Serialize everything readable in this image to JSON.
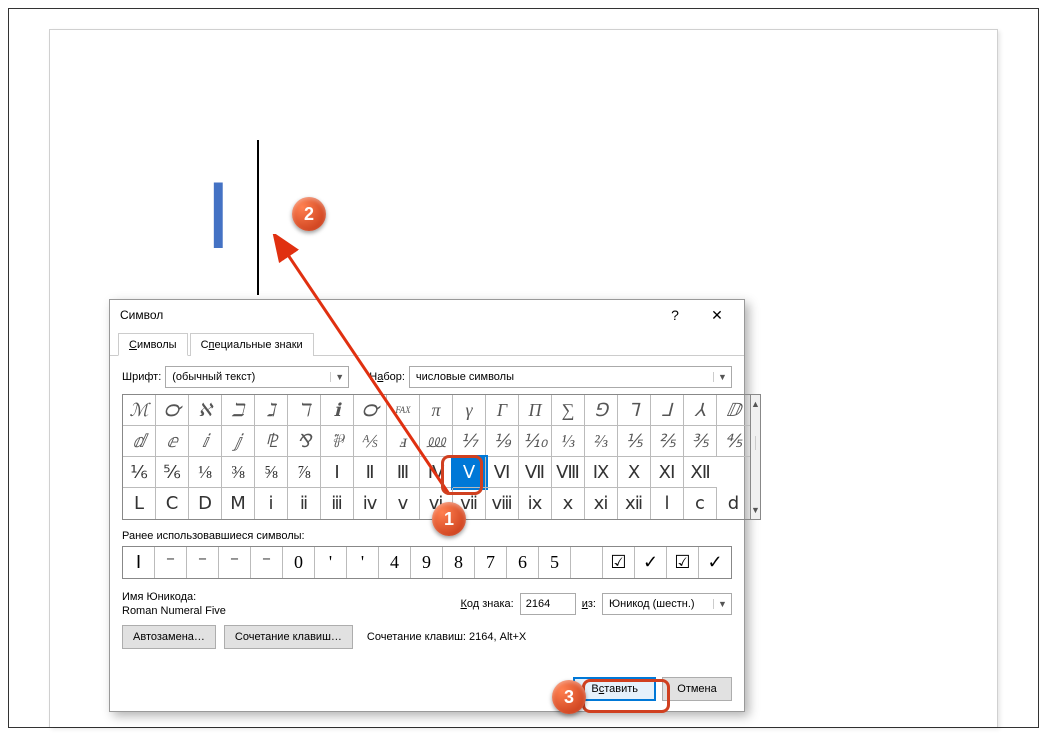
{
  "document": {
    "inserted_char": "Ⅰ"
  },
  "dialog": {
    "title": "Символ",
    "help": "?",
    "close": "✕",
    "tabs": {
      "symbols": "Символы",
      "special": "Специальные знаки"
    },
    "font_label": "Шрифт:",
    "font_value": "(обычный текст)",
    "set_label": "Набор:",
    "set_value": "числовые символы",
    "recent_label": "Ранее использовавшиеся символы:",
    "unicode_name_label": "Имя Юникода:",
    "unicode_name": "Roman Numeral Five",
    "code_label": "Код знака:",
    "code_value": "2164",
    "from_label": "из:",
    "from_value": "Юникод (шестн.)",
    "autocorrect": "Автозамена…",
    "shortcut_btn": "Сочетание клавиш…",
    "shortcut_text": "Сочетание клавиш: 2164, Alt+X",
    "insert": "Вставить",
    "cancel": "Отмена"
  },
  "grid": {
    "r1": [
      "ℳ",
      "℺",
      "ℵ",
      "ℶ",
      "ℷ",
      "ℸ",
      "ℹ",
      "℺",
      "FAX",
      "π",
      "γ",
      "Γ",
      "Π",
      "∑",
      "⅁",
      "⅂",
      "⅃",
      "⅄",
      "ⅅ"
    ],
    "r2": [
      "ⅆ",
      "ⅇ",
      "ⅈ",
      "ⅉ",
      "⅊",
      "⅋",
      "⅌",
      "⅍",
      "ⅎ",
      "⅏",
      "⅐",
      "⅑",
      "⅒",
      "⅓",
      "⅔",
      "⅕",
      "⅖",
      "⅗",
      "⅘"
    ],
    "r3": [
      "⅙",
      "⅚",
      "⅛",
      "⅜",
      "⅝",
      "⅞",
      "Ⅰ",
      "Ⅱ",
      "Ⅲ",
      "Ⅳ",
      "Ⅴ",
      "Ⅵ",
      "Ⅶ",
      "Ⅷ",
      "Ⅸ",
      "Ⅹ",
      "Ⅺ",
      "Ⅻ"
    ],
    "r4": [
      "Ⅼ",
      "Ⅽ",
      "Ⅾ",
      "Ⅿ",
      "ⅰ",
      "ⅱ",
      "ⅲ",
      "ⅳ",
      "ⅴ",
      "ⅵ",
      "ⅶ",
      "ⅷ",
      "ⅸ",
      "ⅹ",
      "ⅺ",
      "ⅻ",
      "ⅼ",
      "ⅽ",
      "ⅾ"
    ]
  },
  "recent": [
    "Ⅰ",
    "⁻",
    "⁻",
    "⁻",
    "⁻",
    "0",
    "'",
    "'",
    "4",
    "9",
    "8",
    "7",
    "6",
    "5",
    "",
    "☑",
    "✓",
    "☑",
    "✓"
  ],
  "badges": {
    "b1": "1",
    "b2": "2",
    "b3": "3"
  }
}
